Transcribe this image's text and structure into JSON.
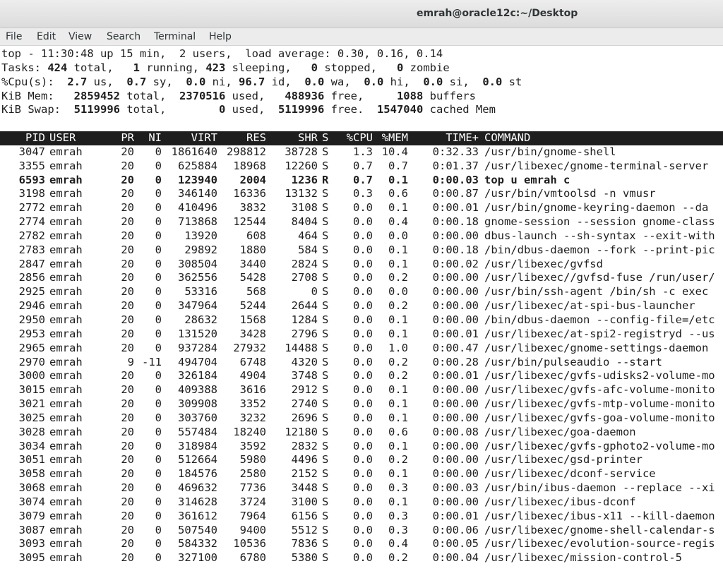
{
  "window": {
    "title": "emrah@oracle12c:~/Desktop"
  },
  "menu": [
    "File",
    "Edit",
    "View",
    "Search",
    "Terminal",
    "Help"
  ],
  "summary": [
    [
      {
        "t": "top - 11:30:48 up 15 min,  2 users,  load average: 0.30, 0.16, 0.14"
      }
    ],
    [
      {
        "t": "Tasks: "
      },
      {
        "t": "424",
        "b": true
      },
      {
        "t": " total,   "
      },
      {
        "t": "1",
        "b": true
      },
      {
        "t": " running, "
      },
      {
        "t": "423",
        "b": true
      },
      {
        "t": " sleeping,   "
      },
      {
        "t": "0",
        "b": true
      },
      {
        "t": " stopped,   "
      },
      {
        "t": "0",
        "b": true
      },
      {
        "t": " zombie"
      }
    ],
    [
      {
        "t": "%Cpu(s):  "
      },
      {
        "t": "2.7",
        "b": true
      },
      {
        "t": " us,  "
      },
      {
        "t": "0.7",
        "b": true
      },
      {
        "t": " sy,  "
      },
      {
        "t": "0.0",
        "b": true
      },
      {
        "t": " ni, "
      },
      {
        "t": "96.7",
        "b": true
      },
      {
        "t": " id,  "
      },
      {
        "t": "0.0",
        "b": true
      },
      {
        "t": " wa,  "
      },
      {
        "t": "0.0",
        "b": true
      },
      {
        "t": " hi,  "
      },
      {
        "t": "0.0",
        "b": true
      },
      {
        "t": " si,  "
      },
      {
        "t": "0.0",
        "b": true
      },
      {
        "t": " st"
      }
    ],
    [
      {
        "t": "KiB Mem:   "
      },
      {
        "t": "2859452",
        "b": true
      },
      {
        "t": " total,  "
      },
      {
        "t": "2370516",
        "b": true
      },
      {
        "t": " used,   "
      },
      {
        "t": "488936",
        "b": true
      },
      {
        "t": " free,     "
      },
      {
        "t": "1088",
        "b": true
      },
      {
        "t": " buffers"
      }
    ],
    [
      {
        "t": "KiB Swap:  "
      },
      {
        "t": "5119996",
        "b": true
      },
      {
        "t": " total,        "
      },
      {
        "t": "0",
        "b": true
      },
      {
        "t": " used,  "
      },
      {
        "t": "5119996",
        "b": true
      },
      {
        "t": " free.  "
      },
      {
        "t": "1547040",
        "b": true
      },
      {
        "t": " cached Mem"
      }
    ]
  ],
  "columns": [
    "PID",
    "USER",
    "PR",
    "NI",
    "VIRT",
    "RES",
    "SHR",
    "S",
    "%CPU",
    "%MEM",
    "TIME+",
    "COMMAND"
  ],
  "processes": [
    [
      "3047",
      "emrah",
      "20",
      "0",
      "1861640",
      "298812",
      "38728",
      "S",
      "1.3",
      "10.4",
      "0:32.33",
      "/usr/bin/gnome-shell"
    ],
    [
      "3355",
      "emrah",
      "20",
      "0",
      "625884",
      "18968",
      "12260",
      "S",
      "0.7",
      "0.7",
      "0:01.37",
      "/usr/libexec/gnome-terminal-server"
    ],
    [
      "6593",
      "emrah",
      "20",
      "0",
      "123940",
      "2004",
      "1236",
      "R",
      "0.7",
      "0.1",
      "0:00.03",
      "top u emrah c"
    ],
    [
      "3198",
      "emrah",
      "20",
      "0",
      "346140",
      "16336",
      "13132",
      "S",
      "0.3",
      "0.6",
      "0:00.87",
      "/usr/bin/vmtoolsd -n vmusr"
    ],
    [
      "2772",
      "emrah",
      "20",
      "0",
      "410496",
      "3832",
      "3108",
      "S",
      "0.0",
      "0.1",
      "0:00.01",
      "/usr/bin/gnome-keyring-daemon --da"
    ],
    [
      "2774",
      "emrah",
      "20",
      "0",
      "713868",
      "12544",
      "8404",
      "S",
      "0.0",
      "0.4",
      "0:00.18",
      "gnome-session --session gnome-class"
    ],
    [
      "2782",
      "emrah",
      "20",
      "0",
      "13920",
      "608",
      "464",
      "S",
      "0.0",
      "0.0",
      "0:00.00",
      "dbus-launch --sh-syntax --exit-with"
    ],
    [
      "2783",
      "emrah",
      "20",
      "0",
      "29892",
      "1880",
      "584",
      "S",
      "0.0",
      "0.1",
      "0:00.18",
      "/bin/dbus-daemon --fork --print-pic"
    ],
    [
      "2847",
      "emrah",
      "20",
      "0",
      "308504",
      "3440",
      "2824",
      "S",
      "0.0",
      "0.1",
      "0:00.02",
      "/usr/libexec/gvfsd"
    ],
    [
      "2856",
      "emrah",
      "20",
      "0",
      "362556",
      "5428",
      "2708",
      "S",
      "0.0",
      "0.2",
      "0:00.00",
      "/usr/libexec//gvfsd-fuse /run/user/"
    ],
    [
      "2925",
      "emrah",
      "20",
      "0",
      "53316",
      "568",
      "0",
      "S",
      "0.0",
      "0.0",
      "0:00.00",
      "/usr/bin/ssh-agent /bin/sh -c exec"
    ],
    [
      "2946",
      "emrah",
      "20",
      "0",
      "347964",
      "5244",
      "2644",
      "S",
      "0.0",
      "0.2",
      "0:00.00",
      "/usr/libexec/at-spi-bus-launcher"
    ],
    [
      "2950",
      "emrah",
      "20",
      "0",
      "28632",
      "1568",
      "1284",
      "S",
      "0.0",
      "0.1",
      "0:00.00",
      "/bin/dbus-daemon --config-file=/etc"
    ],
    [
      "2953",
      "emrah",
      "20",
      "0",
      "131520",
      "3428",
      "2796",
      "S",
      "0.0",
      "0.1",
      "0:00.01",
      "/usr/libexec/at-spi2-registryd --us"
    ],
    [
      "2965",
      "emrah",
      "20",
      "0",
      "937284",
      "27932",
      "14488",
      "S",
      "0.0",
      "1.0",
      "0:00.47",
      "/usr/libexec/gnome-settings-daemon"
    ],
    [
      "2970",
      "emrah",
      "9",
      "-11",
      "494704",
      "6748",
      "4320",
      "S",
      "0.0",
      "0.2",
      "0:00.28",
      "/usr/bin/pulseaudio --start"
    ],
    [
      "3000",
      "emrah",
      "20",
      "0",
      "326184",
      "4904",
      "3748",
      "S",
      "0.0",
      "0.2",
      "0:00.01",
      "/usr/libexec/gvfs-udisks2-volume-mo"
    ],
    [
      "3015",
      "emrah",
      "20",
      "0",
      "409388",
      "3616",
      "2912",
      "S",
      "0.0",
      "0.1",
      "0:00.00",
      "/usr/libexec/gvfs-afc-volume-monito"
    ],
    [
      "3021",
      "emrah",
      "20",
      "0",
      "309908",
      "3352",
      "2740",
      "S",
      "0.0",
      "0.1",
      "0:00.00",
      "/usr/libexec/gvfs-mtp-volume-monito"
    ],
    [
      "3025",
      "emrah",
      "20",
      "0",
      "303760",
      "3232",
      "2696",
      "S",
      "0.0",
      "0.1",
      "0:00.00",
      "/usr/libexec/gvfs-goa-volume-monito"
    ],
    [
      "3028",
      "emrah",
      "20",
      "0",
      "557484",
      "18240",
      "12180",
      "S",
      "0.0",
      "0.6",
      "0:00.08",
      "/usr/libexec/goa-daemon"
    ],
    [
      "3034",
      "emrah",
      "20",
      "0",
      "318984",
      "3592",
      "2832",
      "S",
      "0.0",
      "0.1",
      "0:00.00",
      "/usr/libexec/gvfs-gphoto2-volume-mo"
    ],
    [
      "3051",
      "emrah",
      "20",
      "0",
      "512664",
      "5980",
      "4496",
      "S",
      "0.0",
      "0.2",
      "0:00.00",
      "/usr/libexec/gsd-printer"
    ],
    [
      "3058",
      "emrah",
      "20",
      "0",
      "184576",
      "2580",
      "2152",
      "S",
      "0.0",
      "0.1",
      "0:00.00",
      "/usr/libexec/dconf-service"
    ],
    [
      "3068",
      "emrah",
      "20",
      "0",
      "469632",
      "7736",
      "3448",
      "S",
      "0.0",
      "0.3",
      "0:00.03",
      "/usr/bin/ibus-daemon --replace --xi"
    ],
    [
      "3074",
      "emrah",
      "20",
      "0",
      "314628",
      "3724",
      "3100",
      "S",
      "0.0",
      "0.1",
      "0:00.00",
      "/usr/libexec/ibus-dconf"
    ],
    [
      "3079",
      "emrah",
      "20",
      "0",
      "361612",
      "7964",
      "6156",
      "S",
      "0.0",
      "0.3",
      "0:00.01",
      "/usr/libexec/ibus-x11 --kill-daemon"
    ],
    [
      "3087",
      "emrah",
      "20",
      "0",
      "507540",
      "9400",
      "5512",
      "S",
      "0.0",
      "0.3",
      "0:00.06",
      "/usr/libexec/gnome-shell-calendar-s"
    ],
    [
      "3093",
      "emrah",
      "20",
      "0",
      "584332",
      "10536",
      "7836",
      "S",
      "0.0",
      "0.4",
      "0:00.05",
      "/usr/libexec/evolution-source-regis"
    ],
    [
      "3095",
      "emrah",
      "20",
      "0",
      "327100",
      "6780",
      "5380",
      "S",
      "0.0",
      "0.2",
      "0:00.04",
      "/usr/libexec/mission-control-5"
    ]
  ],
  "highlighted_pid": "6593"
}
